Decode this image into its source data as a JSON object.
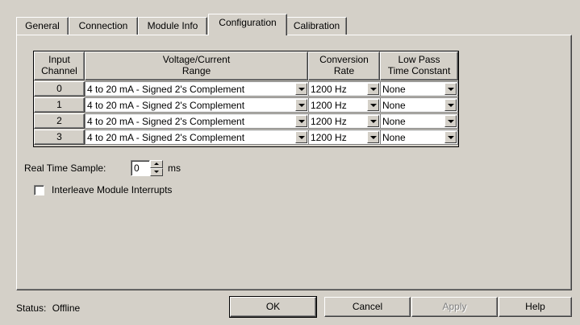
{
  "tabs": [
    {
      "label": "General"
    },
    {
      "label": "Connection"
    },
    {
      "label": "Module Info"
    },
    {
      "label": "Configuration",
      "active": true
    },
    {
      "label": "Calibration"
    }
  ],
  "table": {
    "headers": {
      "channel_line1": "Input",
      "channel_line2": "Channel",
      "range_line1": "Voltage/Current",
      "range_line2": "Range",
      "rate_line1": "Conversion",
      "rate_line2": "Rate",
      "filter_line1": "Low Pass",
      "filter_line2": "Time Constant"
    },
    "rows": [
      {
        "channel": "0",
        "range": "4 to 20 mA - Signed 2's Complement",
        "rate": "1200 Hz",
        "filter": "None"
      },
      {
        "channel": "1",
        "range": "4 to 20 mA - Signed 2's Complement",
        "rate": "1200 Hz",
        "filter": "None"
      },
      {
        "channel": "2",
        "range": "4 to 20 mA - Signed 2's Complement",
        "rate": "1200 Hz",
        "filter": "None"
      },
      {
        "channel": "3",
        "range": "4 to 20 mA - Signed 2's Complement",
        "rate": "1200 Hz",
        "filter": "None"
      }
    ]
  },
  "real_time_sample": {
    "label": "Real Time Sample:",
    "value": "0",
    "unit": "ms"
  },
  "interleave": {
    "label": "Interleave Module Interrupts",
    "checked": false
  },
  "status": {
    "label": "Status:",
    "value": "Offline"
  },
  "buttons": {
    "ok": "OK",
    "cancel": "Cancel",
    "apply": "Apply",
    "help": "Help"
  }
}
